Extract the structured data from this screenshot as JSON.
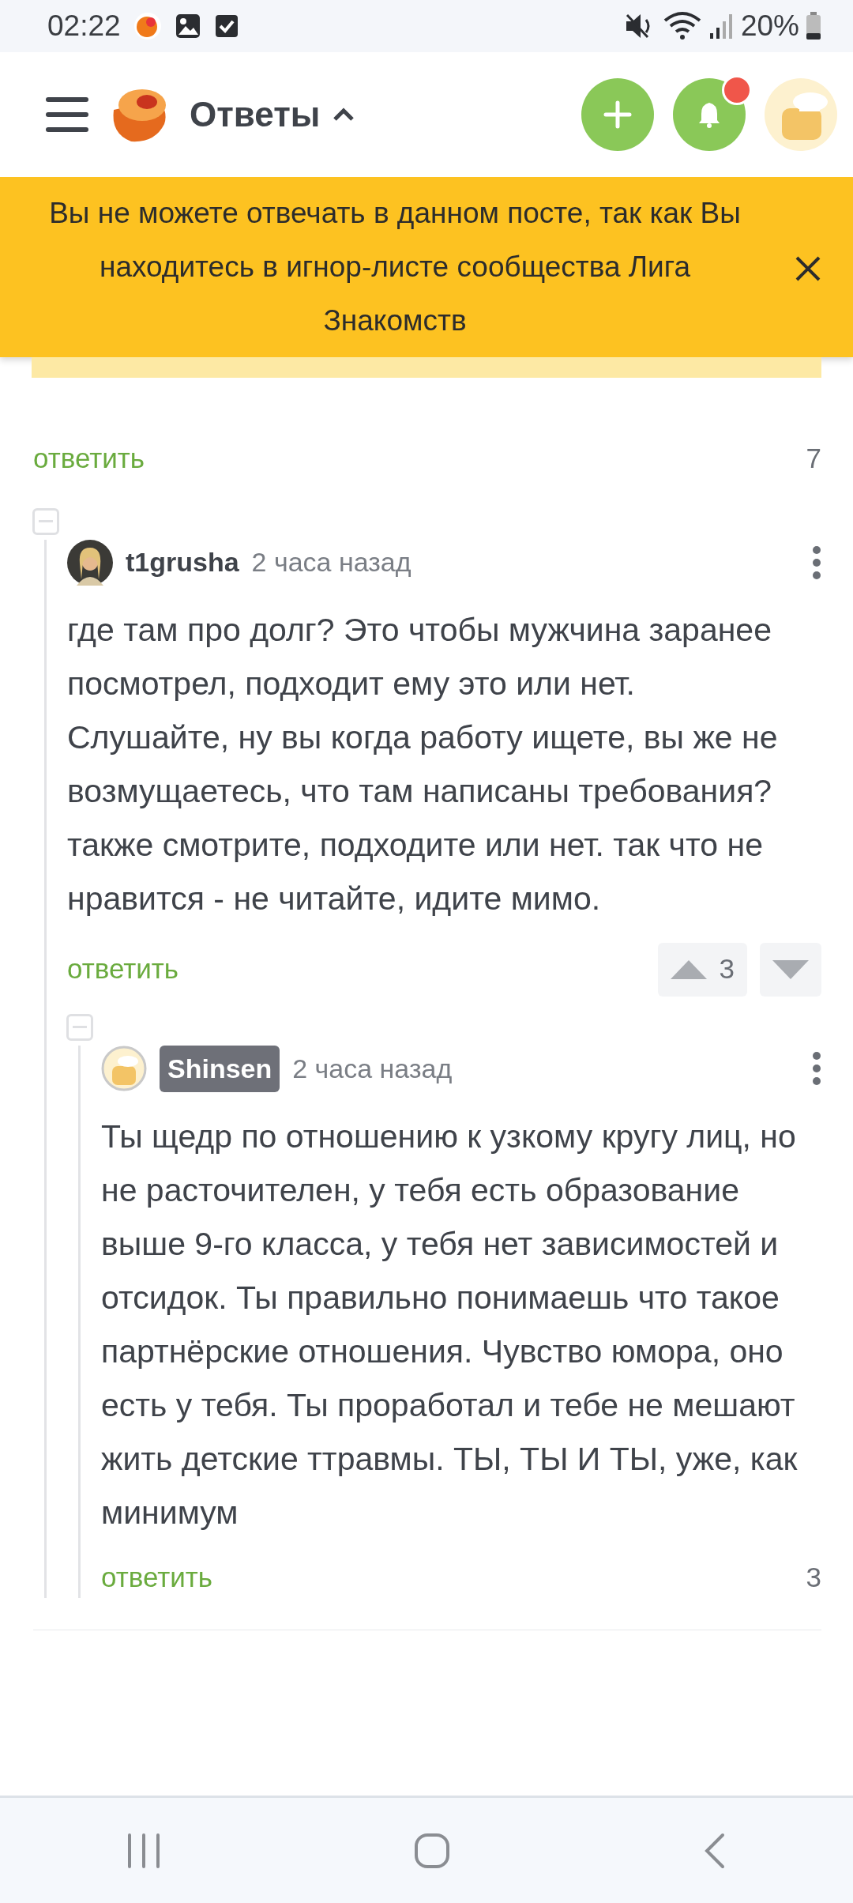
{
  "status_bar": {
    "time": "02:22",
    "battery": "20%"
  },
  "header": {
    "title": "Ответы",
    "notifications_new": true
  },
  "banner": {
    "text": "Вы не можете отвечать в данном посте, так как Вы находитесь в игнор-листе сообщества Лига Знакомств"
  },
  "post_footer": {
    "reply": "ответить",
    "count": "7"
  },
  "comments": [
    {
      "author": "t1grusha",
      "author_badge": false,
      "time": "2 часа назад",
      "text": "где там про долг?  Это чтобы мужчина заранее посмотрел, подходит ему это или нет. Слушайте, ну вы когда работу ищете, вы же не возмущаетесь, что там написаны требования? также смотрите, подходите или нет. так что не нравится - не читайте, идите мимо.",
      "reply": "ответить",
      "kind": "vote_buttons",
      "rating": "3",
      "children": [
        {
          "author": "Shinsen",
          "author_badge": true,
          "time": "2 часа назад",
          "text": "Ты щедр по отношению к узкому кругу лиц, но не расточителен, у тебя есть образование выше 9-го класса, у тебя нет зависимостей и отсидок. Ты правильно понимаешь что такое партнёрские отношения. Чувство юмора, оно есть у тебя. Ты проработал и тебе не мешают жить детские ттравмы. ТЫ, ТЫ И ТЫ, уже, как минимум",
          "reply": "ответить",
          "kind": "plain_count",
          "rating": "3"
        }
      ]
    }
  ]
}
